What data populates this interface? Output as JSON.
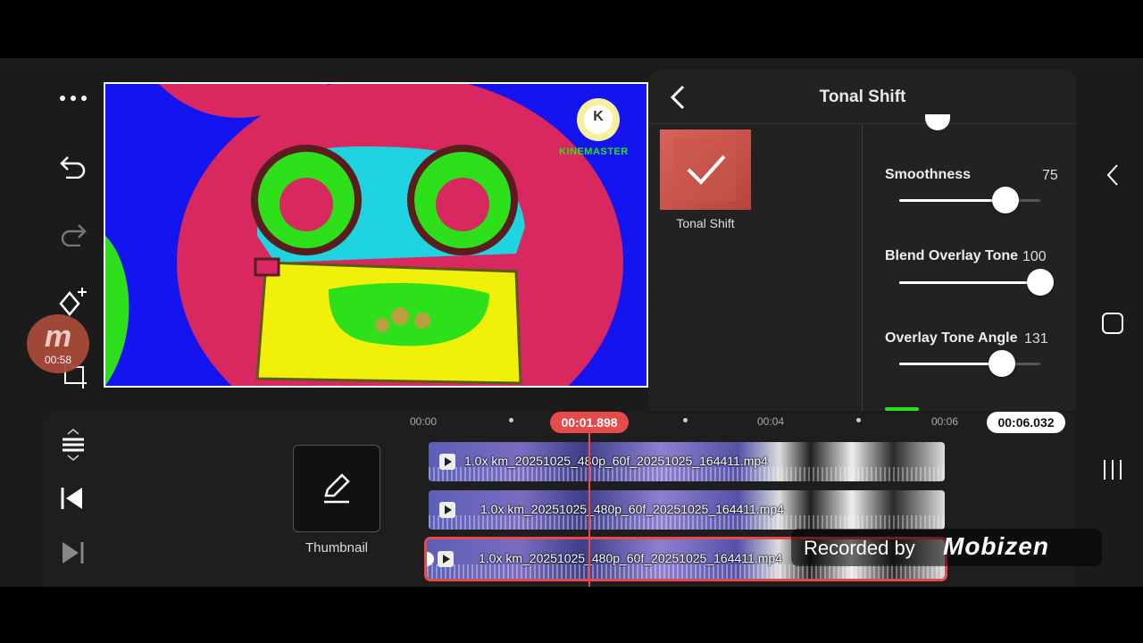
{
  "colors": {
    "accent": "#e84a4a",
    "panel": "#222222",
    "slider_fill": "#ffffff"
  },
  "toolbar": {
    "icons": [
      "more-icon",
      "undo-icon",
      "redo-icon",
      "keyframe-add-icon",
      "crop-icon"
    ]
  },
  "recorder": {
    "time": "00:58",
    "logo": "m"
  },
  "preview": {
    "watermark": "KINEMASTER",
    "watermark_letter": "K"
  },
  "panel": {
    "title": "Tonal Shift",
    "effect": {
      "label": "Tonal Shift",
      "selected": true
    },
    "sliders": [
      {
        "label": "Smoothness",
        "value": "75",
        "level": 0.75
      },
      {
        "label": "Blend Overlay Tone",
        "value": "100",
        "level": 1.0
      },
      {
        "label": "Overlay Tone Angle",
        "value": "131",
        "level": 0.73
      }
    ]
  },
  "timeline": {
    "ticks": [
      "00:00",
      "00:04",
      "00:06"
    ],
    "playhead": "00:01.898",
    "end_time": "00:06.032",
    "thumbnail_label": "Thumbnail",
    "clips": [
      {
        "name": "1.0x km_20251025_480p_60f_20251025_164411.mp4"
      },
      {
        "name": "1.0x km_20251025_480p_60f_20251025_164411.mp4"
      },
      {
        "name": "1.0x km_20251025_480p_60f_20251025_164411.mp4",
        "selected": true
      }
    ]
  },
  "overlay": {
    "recorded_by": "Recorded by",
    "brand": "Mobizen"
  }
}
